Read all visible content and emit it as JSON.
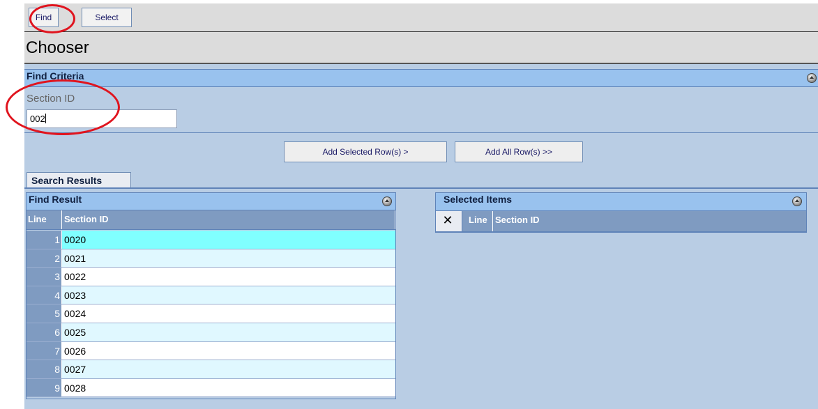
{
  "toolbar": {
    "find_label": "Find",
    "select_label": "Select"
  },
  "page_title": "Chooser",
  "find_criteria": {
    "header": "Find Criteria",
    "field_label": "Section ID",
    "field_value": "002"
  },
  "actions": {
    "add_selected": "Add Selected Row(s) >",
    "add_all": "Add All Row(s) >>"
  },
  "tab_search_results": "Search Results",
  "find_result": {
    "header": "Find Result",
    "columns": [
      "Line",
      "Section ID"
    ],
    "rows": [
      {
        "line": "1",
        "section_id": "0020"
      },
      {
        "line": "2",
        "section_id": "0021"
      },
      {
        "line": "3",
        "section_id": "0022"
      },
      {
        "line": "4",
        "section_id": "0023"
      },
      {
        "line": "5",
        "section_id": "0024"
      },
      {
        "line": "6",
        "section_id": "0025"
      },
      {
        "line": "7",
        "section_id": "0026"
      },
      {
        "line": "8",
        "section_id": "0027"
      },
      {
        "line": "9",
        "section_id": "0028"
      }
    ],
    "highlighted_row": 1
  },
  "selected_items": {
    "header": "Selected Items",
    "columns": [
      "Line",
      "Section ID"
    ],
    "rows": []
  },
  "colors": {
    "panel_background": "#b9cde4",
    "header_bar": "#99c2ee",
    "column_header": "#7f9bc1",
    "row_highlight": "#80ffff",
    "row_alt": "#e0f8ff",
    "annotation_ring": "#e0141e"
  },
  "icons": [
    "collapse-icon",
    "delete-column-icon"
  ]
}
